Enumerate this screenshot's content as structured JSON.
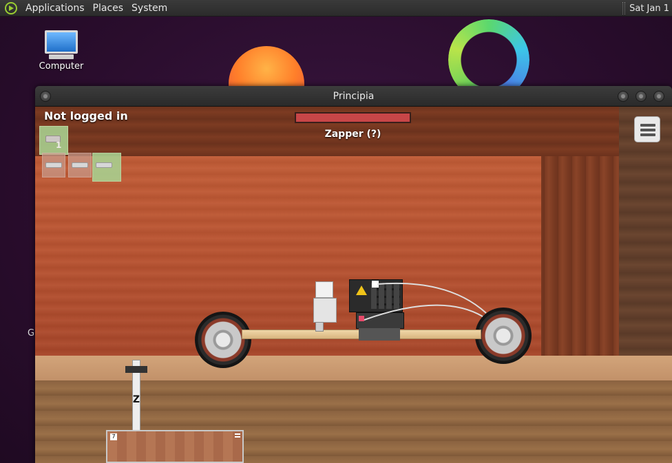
{
  "top_panel": {
    "menus": [
      "Applications",
      "Places",
      "System"
    ],
    "clock": "Sat Jan 1"
  },
  "desktop": {
    "icon_label": "Computer",
    "partial_label": "G"
  },
  "window": {
    "title": "Principia"
  },
  "game": {
    "login_status": "Not logged in",
    "tool_slot_number": "1",
    "crate_number": "7",
    "weapon_label": "Zapper (?)",
    "health_fraction": 1.0,
    "lever_key": "Z",
    "colors": {
      "health": "#c84648",
      "active_tool": "#a9cf8f",
      "inactive_tool": "#c89a8a"
    }
  }
}
